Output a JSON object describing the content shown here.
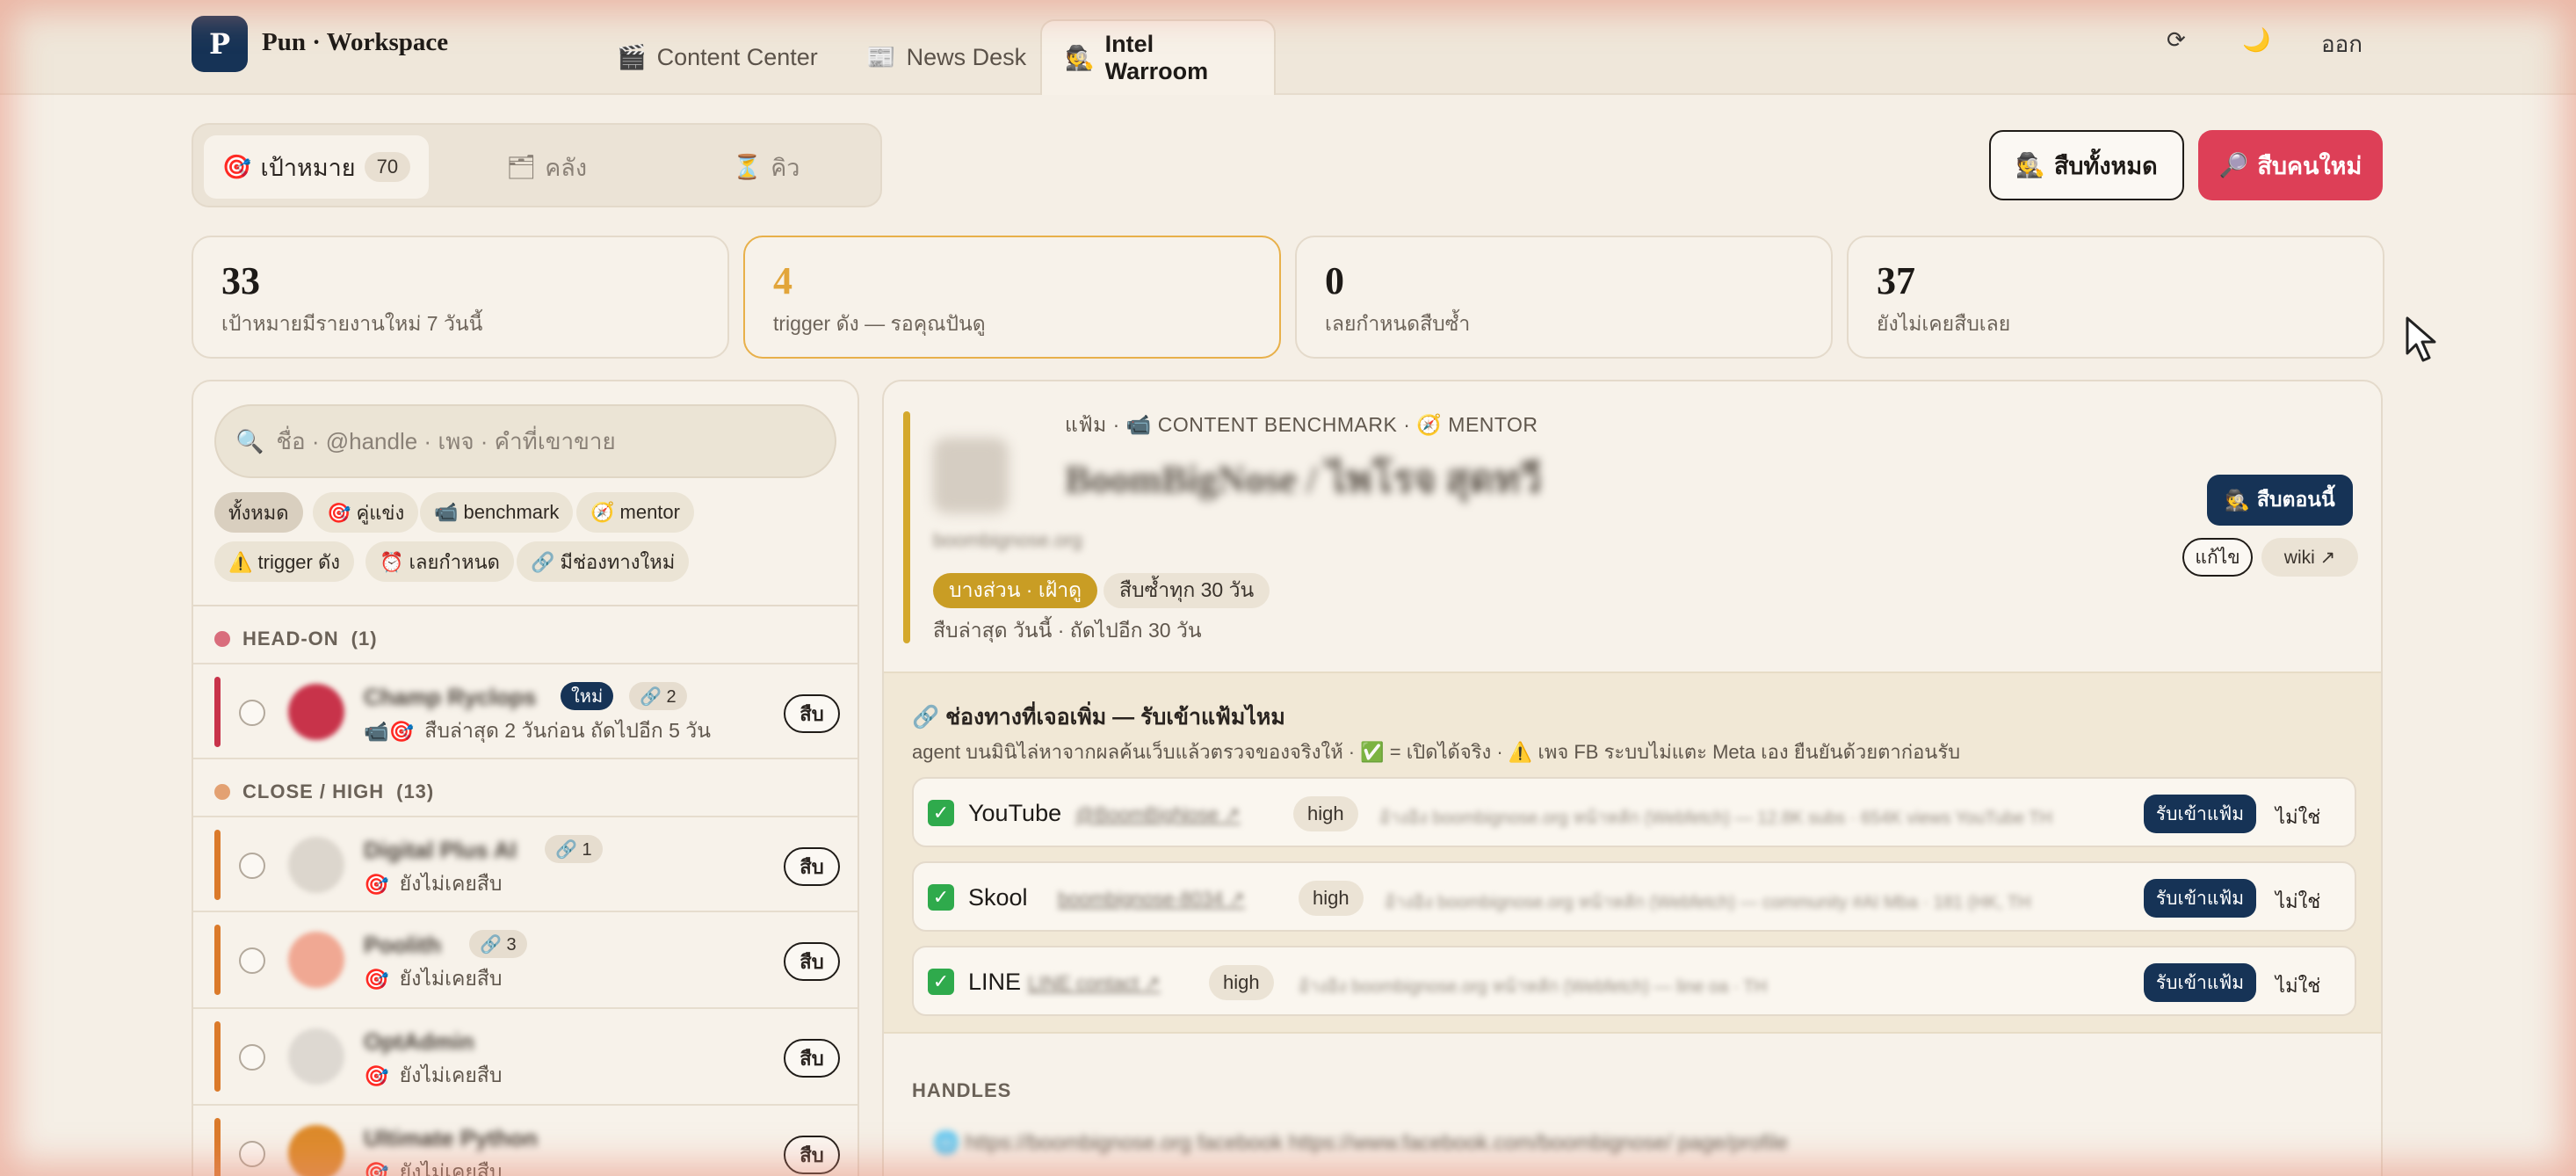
{
  "header": {
    "logo_letter": "P",
    "app_title": "Pun · Workspace",
    "tabs": [
      {
        "icon": "🎬",
        "label": "Content Center"
      },
      {
        "icon": "📰",
        "label": "News Desk"
      },
      {
        "icon": "🕵",
        "label": "Intel Warroom"
      }
    ],
    "refresh_glyph": "⟳",
    "theme_glyph": "🌙",
    "logout_label": "ออก"
  },
  "segments": [
    {
      "icon": "🎯",
      "label": "เป้าหมาย",
      "count": "70"
    },
    {
      "icon": "🗂",
      "label": "คลัง"
    },
    {
      "icon": "⏳",
      "label": "คิว"
    }
  ],
  "actions": {
    "investigate_all": {
      "icon": "🕵",
      "label": "สืบทั้งหมด"
    },
    "investigate_new": {
      "icon": "🔎",
      "label": "สืบคนใหม่"
    }
  },
  "stats": [
    {
      "value": "33",
      "label": "เป้าหมายมีรายงานใหม่ 7 วันนี้"
    },
    {
      "value": "4",
      "label": "trigger ดัง — รอคุณปันดู"
    },
    {
      "value": "0",
      "label": "เลยกำหนดสืบซ้ำ"
    },
    {
      "value": "37",
      "label": "ยังไม่เคยสืบเลย"
    }
  ],
  "search": {
    "placeholder": "ชื่อ · @handle · เพจ · คำที่เขาขาย"
  },
  "filters": [
    {
      "label": "ทั้งหมด"
    },
    {
      "label": "🎯 คู่แข่ง"
    },
    {
      "label": "📹 benchmark"
    },
    {
      "label": "🧭 mentor"
    },
    {
      "label": "⚠️ trigger ดัง"
    },
    {
      "label": "⏰ เลยกำหนด"
    },
    {
      "label": "🔗 มีช่องทางใหม่"
    }
  ],
  "groups": [
    {
      "title": "HEAD-ON",
      "count": "(1)",
      "color": "#d96d7c"
    },
    {
      "title": "CLOSE / HIGH",
      "count": "(13)",
      "color": "#e3a172"
    }
  ],
  "rows": [
    {
      "name": "Champ Ryclops",
      "new_badge": "ใหม่",
      "links": "🔗 2",
      "icons": "📹🎯",
      "status": "สืบล่าสุด 2 วันก่อน  ถัดไปอีก 5 วัน",
      "bar_color": "#c8334a",
      "avatar_color": "#c8334a"
    },
    {
      "name": "Digital Plus AI",
      "links": "🔗 1",
      "icons": "🎯",
      "status": "ยังไม่เคยสืบ",
      "bar_color": "#db7a2a",
      "avatar_color": "#dcd6cd"
    },
    {
      "name": "Poolith",
      "links": "🔗 3",
      "icons": "🎯",
      "status": "ยังไม่เคยสืบ",
      "bar_color": "#db7a2a",
      "avatar_color": "#f0a893"
    },
    {
      "name": "OptAdmin",
      "icons": "🎯",
      "status": "ยังไม่เคยสืบ",
      "bar_color": "#db7a2a",
      "avatar_color": "#ddd8d1"
    },
    {
      "name": "Ultimate Python",
      "icons": "🎯",
      "status": "ยังไม่เคยสืบ",
      "bar_color": "#db7a2a",
      "avatar_color": "#dd8a2a"
    }
  ],
  "row_action_label": "สืบ",
  "detail": {
    "folder_line": "แฟ้ม · 📹 CONTENT BENCHMARK · 🧭 MENTOR",
    "name": "BoomBigNose / ไพโรจ สุดทวี",
    "url": "boombignose.org",
    "tag_relation": "บางส่วน · เฝ้าดู",
    "tag_cycle": "สืบซ้ำทุก 30 วัน",
    "last_check": "สืบล่าสุด วันนี้ · ถัดไปอีก 30 วัน",
    "investigate_now": {
      "icon": "🕵",
      "label": "สืบตอนนี้"
    },
    "edit_label": "แก้ไข",
    "wiki_label": "wiki ↗"
  },
  "channels": {
    "title": "🔗 ช่องทางที่เจอเพิ่ม — รับเข้าแฟ้มไหม",
    "note": "agent บนมินิไล่หาจากผลค้นเว็บแล้วตรวจของจริงให้ · ✅ = เปิดได้จริง · ⚠️ เพจ FB ระบบไม่แตะ Meta เอง ยืนยันด้วยตาก่อนรับ",
    "accept_label": "รับเข้าแฟ้ม",
    "reject_label": "ไม่ใช่",
    "items": [
      {
        "check": "✓",
        "name": "YouTube",
        "link": "@BoomBigNose ↗",
        "level": "high",
        "desc": "อ้างอิง boombignose.org หน้าหลัก (Webfetch) — 12.8K subs · 654K views YouTube TH"
      },
      {
        "check": "✓",
        "name": "Skool",
        "link": "boombignose-8034 ↗",
        "level": "high",
        "desc": "อ้างอิง boombignose.org หน้าหลัก (Webfetch) — community #AI Mba · 181 (HK, TH"
      },
      {
        "check": "✓",
        "name": "LINE",
        "link": "LINE contact ↗",
        "level": "high",
        "desc": "อ้างอิง boombignose.org หน้าหลัก (Webfetch) — line oa · TH"
      }
    ]
  },
  "handles": {
    "title": "HANDLES",
    "line": "🌐 https://boombignose.org          facebook https://www.facebook.com/boombignose/  page/profile"
  },
  "colors": {
    "navy": "#163356",
    "red": "#dd3f57",
    "gold": "#c99d24",
    "highlight_border": "#e8b04a"
  }
}
